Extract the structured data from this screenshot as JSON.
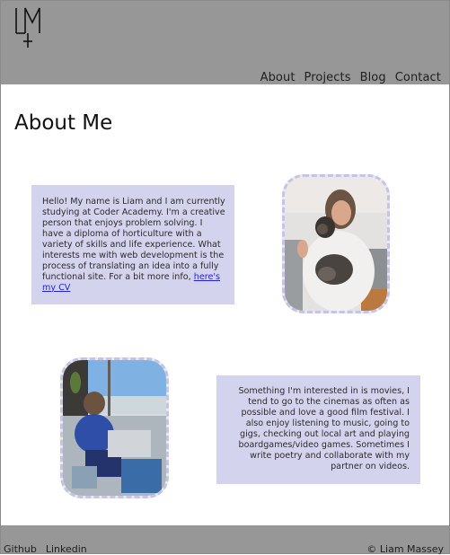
{
  "nav": {
    "items": [
      "About",
      "Projects",
      "Blog",
      "Contact"
    ]
  },
  "page": {
    "title": "About Me"
  },
  "about": {
    "intro_text": "Hello! My name is Liam and I am currently studying at Coder Academy. I'm a creative person that enjoys problem solving. I have a diploma of horticulture with a variety of skills and life experience. What interests me with web development is the process of translating an idea into a fully functional site. For a bit more info,",
    "cv_link": "here's my CV",
    "interests_text": "Something I'm interested in is movies, I tend to go to the cinemas as often as possible and love a good film festival. I also enjoy listening to music, going to gigs, checking out local art and playing boardgames/video games. Sometimes I write poetry and collaborate with my partner on videos."
  },
  "footer": {
    "links": [
      "Github",
      "Linkedin"
    ],
    "copyright": "© Liam Massey"
  },
  "colors": {
    "header_bg": "#979797",
    "card_bg": "#d4d3ee",
    "photo_border": "#c5c4e6",
    "link": "#2323d4"
  }
}
